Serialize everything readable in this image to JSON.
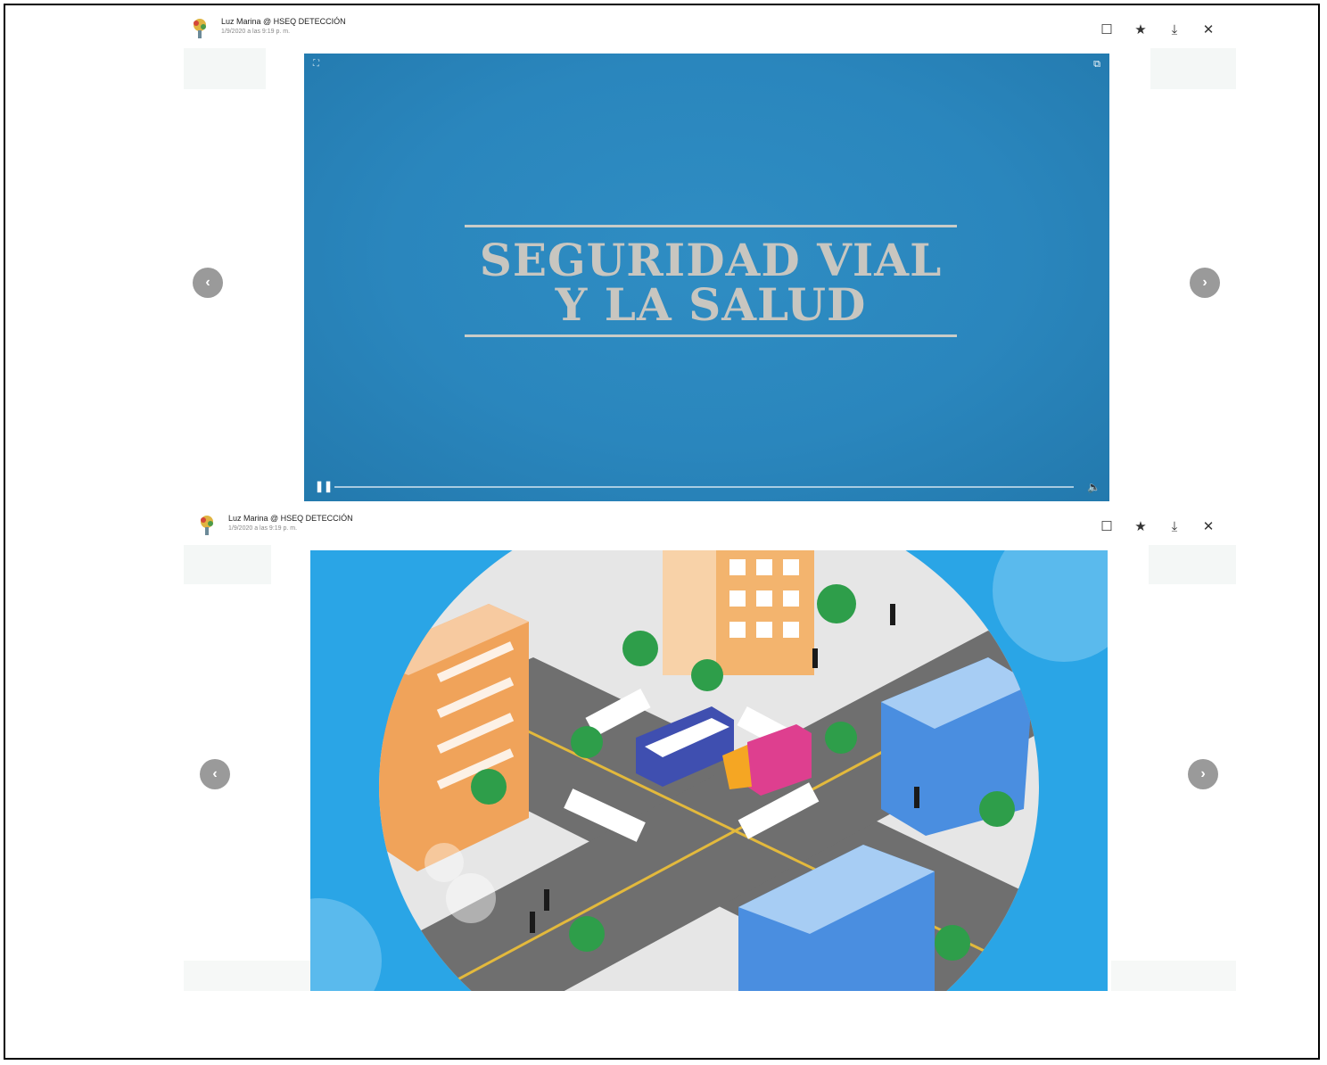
{
  "viewers": [
    {
      "author": "Luz Marina @ HSEQ DETECCIÓN",
      "timestamp": "1/9/2020 a las 9:19 p. m.",
      "media": {
        "type": "video",
        "title_line1": "SEGURIDAD VIAL",
        "title_line2": "Y LA SALUD",
        "background_color": "#2a86bd",
        "playback_progress": 0.0
      }
    },
    {
      "author": "Luz Marina @ HSEQ DETECCIÓN",
      "timestamp": "1/9/2020 a las 9:19 p. m.",
      "media": {
        "type": "image",
        "description_icon": "city-intersection-illustration",
        "background_color": "#2aa5e6"
      }
    }
  ],
  "toolbar": {
    "icons": [
      "comment-icon",
      "star-icon",
      "download-icon",
      "close-icon"
    ],
    "glyph_comment": "☐",
    "glyph_star": "★",
    "glyph_download": "⤓",
    "glyph_close": "✕"
  },
  "nav": {
    "prev_glyph": "‹",
    "next_glyph": "›"
  },
  "player": {
    "pause_glyph": "❚❚",
    "volume_glyph": "🔈",
    "expand_glyph": "⛶",
    "popout_glyph": "⧉"
  }
}
